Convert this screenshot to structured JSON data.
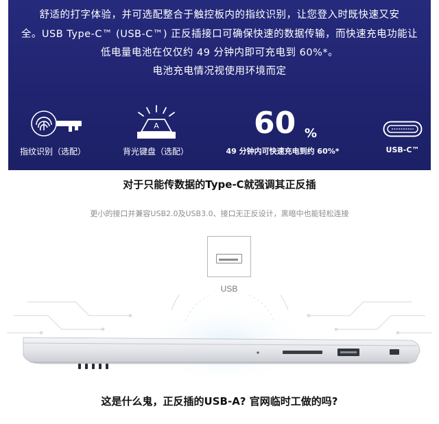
{
  "intro": {
    "line1": "舒适的打字体验，并可选配整合于触控板内的指纹识别，让您登入时既快速又安",
    "line2": "全。USB Type-C™ (USB-C™) 正反插接口可确保快速的数据传输，而快速充电功能让",
    "line3": "低电量电池在仅仅约 49 分钟内即可充电到 60%*。",
    "line4": "电池充电情况视使用环境而定"
  },
  "features": {
    "fingerprint": {
      "label": "指纹识别（选配）",
      "icon": "fingerprint-key-icon"
    },
    "keyboard": {
      "label": "背光键盘（选配）",
      "icon": "backlit-key-icon",
      "key_letter": "A"
    },
    "charge": {
      "value": "60",
      "unit": "%",
      "label": "49 分钟内可快速充电到约 60%*"
    },
    "usbc": {
      "label": "USB-C™",
      "icon": "usb-c-port-icon"
    }
  },
  "section": {
    "heading": "对于只能传数据的Type-C就强调其正反插",
    "subtitle": "更小的接口并兼容USB2.0及USB3.0、接口无正反设计，黑暗中也能轻松连接"
  },
  "usb_callout": {
    "label": "USB",
    "icon": "usb-a-port-icon"
  },
  "caption": "这是什么鬼，正反插的USB-A? 官网临时工做的吗?",
  "colors": {
    "banner": "#22266f",
    "text_dark": "#111111",
    "subtitle": "#8c8c8c"
  }
}
